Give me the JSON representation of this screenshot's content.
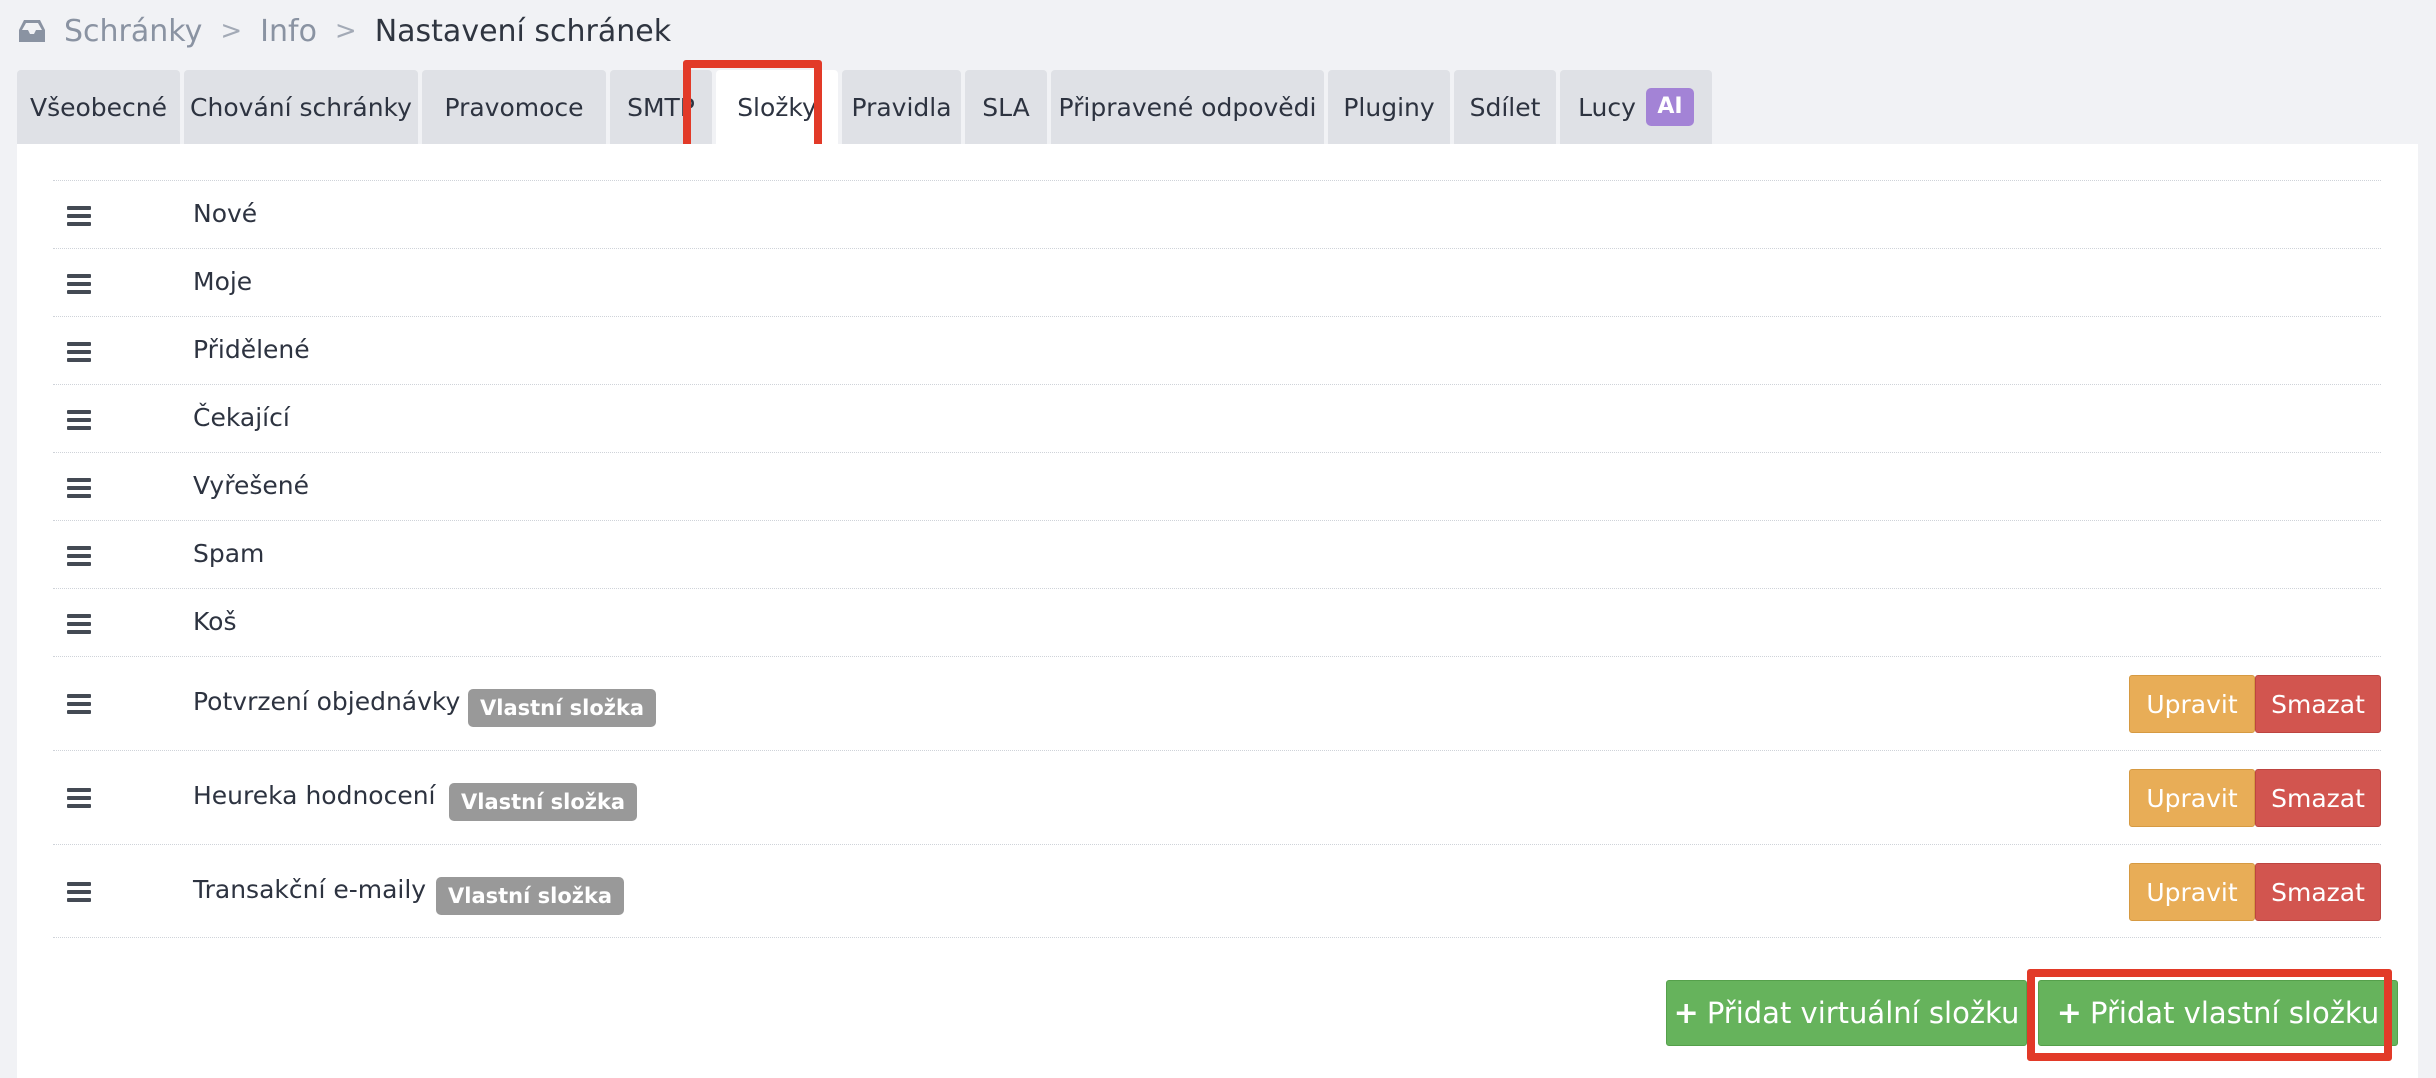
{
  "breadcrumb": {
    "items": [
      "Schránky",
      "Info"
    ],
    "separator": ">",
    "current": "Nastavení schránek"
  },
  "tabs": [
    {
      "label": "Všeobecné"
    },
    {
      "label": "Chování schránky"
    },
    {
      "label": "Pravomoce"
    },
    {
      "label": "SMTP"
    },
    {
      "label": "Složky",
      "active": true
    },
    {
      "label": "Pravidla"
    },
    {
      "label": "SLA"
    },
    {
      "label": "Připravené odpovědi"
    },
    {
      "label": "Pluginy"
    },
    {
      "label": "Sdílet"
    },
    {
      "label": "Lucy",
      "badge": "AI"
    }
  ],
  "folders": [
    {
      "name": "Nové"
    },
    {
      "name": "Moje"
    },
    {
      "name": "Přidělené"
    },
    {
      "name": "Čekající"
    },
    {
      "name": "Vyřešené"
    },
    {
      "name": "Spam"
    },
    {
      "name": "Koš"
    },
    {
      "name": "Potvrzení objednávky",
      "badge": "Vlastní složka",
      "edit": "Upravit",
      "delete": "Smazat"
    },
    {
      "name": "Heureka hodnocení",
      "badge": "Vlastní složka",
      "edit": "Upravit",
      "delete": "Smazat"
    },
    {
      "name": "Transakční e-maily",
      "badge": "Vlastní složka",
      "edit": "Upravit",
      "delete": "Smazat"
    }
  ],
  "actions": {
    "add_virtual": "Přidat virtuální složku",
    "add_custom": "Přidat vlastní složku"
  },
  "colors": {
    "highlight": "#e23a28",
    "green": "#66b35c",
    "edit": "#e8ad57",
    "delete": "#d2554f",
    "badge": "#999999",
    "ai_badge": "#a383d6"
  }
}
